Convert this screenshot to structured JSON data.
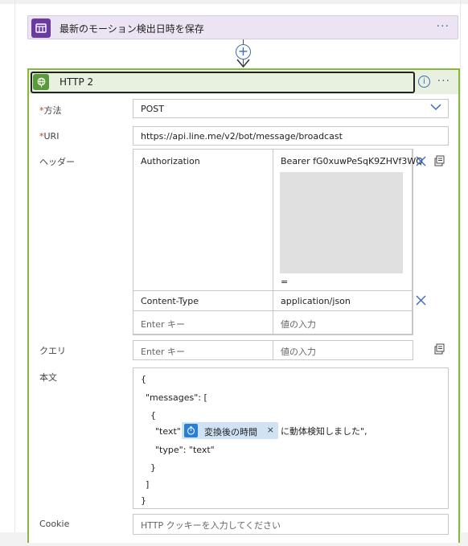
{
  "top_action": {
    "title": "最新のモーション検出日時を保存",
    "more": "···"
  },
  "add_step": "+",
  "http": {
    "title": "HTTP 2",
    "info": "i",
    "more": "···",
    "method": {
      "label": "方法",
      "value": "POST"
    },
    "uri": {
      "label": "URI",
      "value": "https://api.line.me/v2/bot/message/broadcast"
    },
    "headers": {
      "label": "ヘッダー",
      "rows": [
        {
          "key": "Authorization",
          "value": "Bearer fG0xuwPeSqK9ZHVf3WQ",
          "value_tail": "="
        },
        {
          "key": "Content-Type",
          "value": "application/json"
        }
      ],
      "key_placeholder": "Enter キー",
      "value_placeholder": "値の入力"
    },
    "queries": {
      "label": "クエリ",
      "key_placeholder": "Enter キー",
      "value_placeholder": "値の入力"
    },
    "body": {
      "label": "本文",
      "lines": [
        "{",
        "\"messages\": [",
        "{",
        "\"text\": \"",
        "\"type\": \"text\"",
        "}",
        "]",
        "}"
      ],
      "token_label": "変換後の時間",
      "token_remove": "×",
      "text_suffix": "に動体検知しました\","
    },
    "cookie": {
      "label": "Cookie",
      "placeholder": "HTTP クッキーを入力してください"
    }
  }
}
